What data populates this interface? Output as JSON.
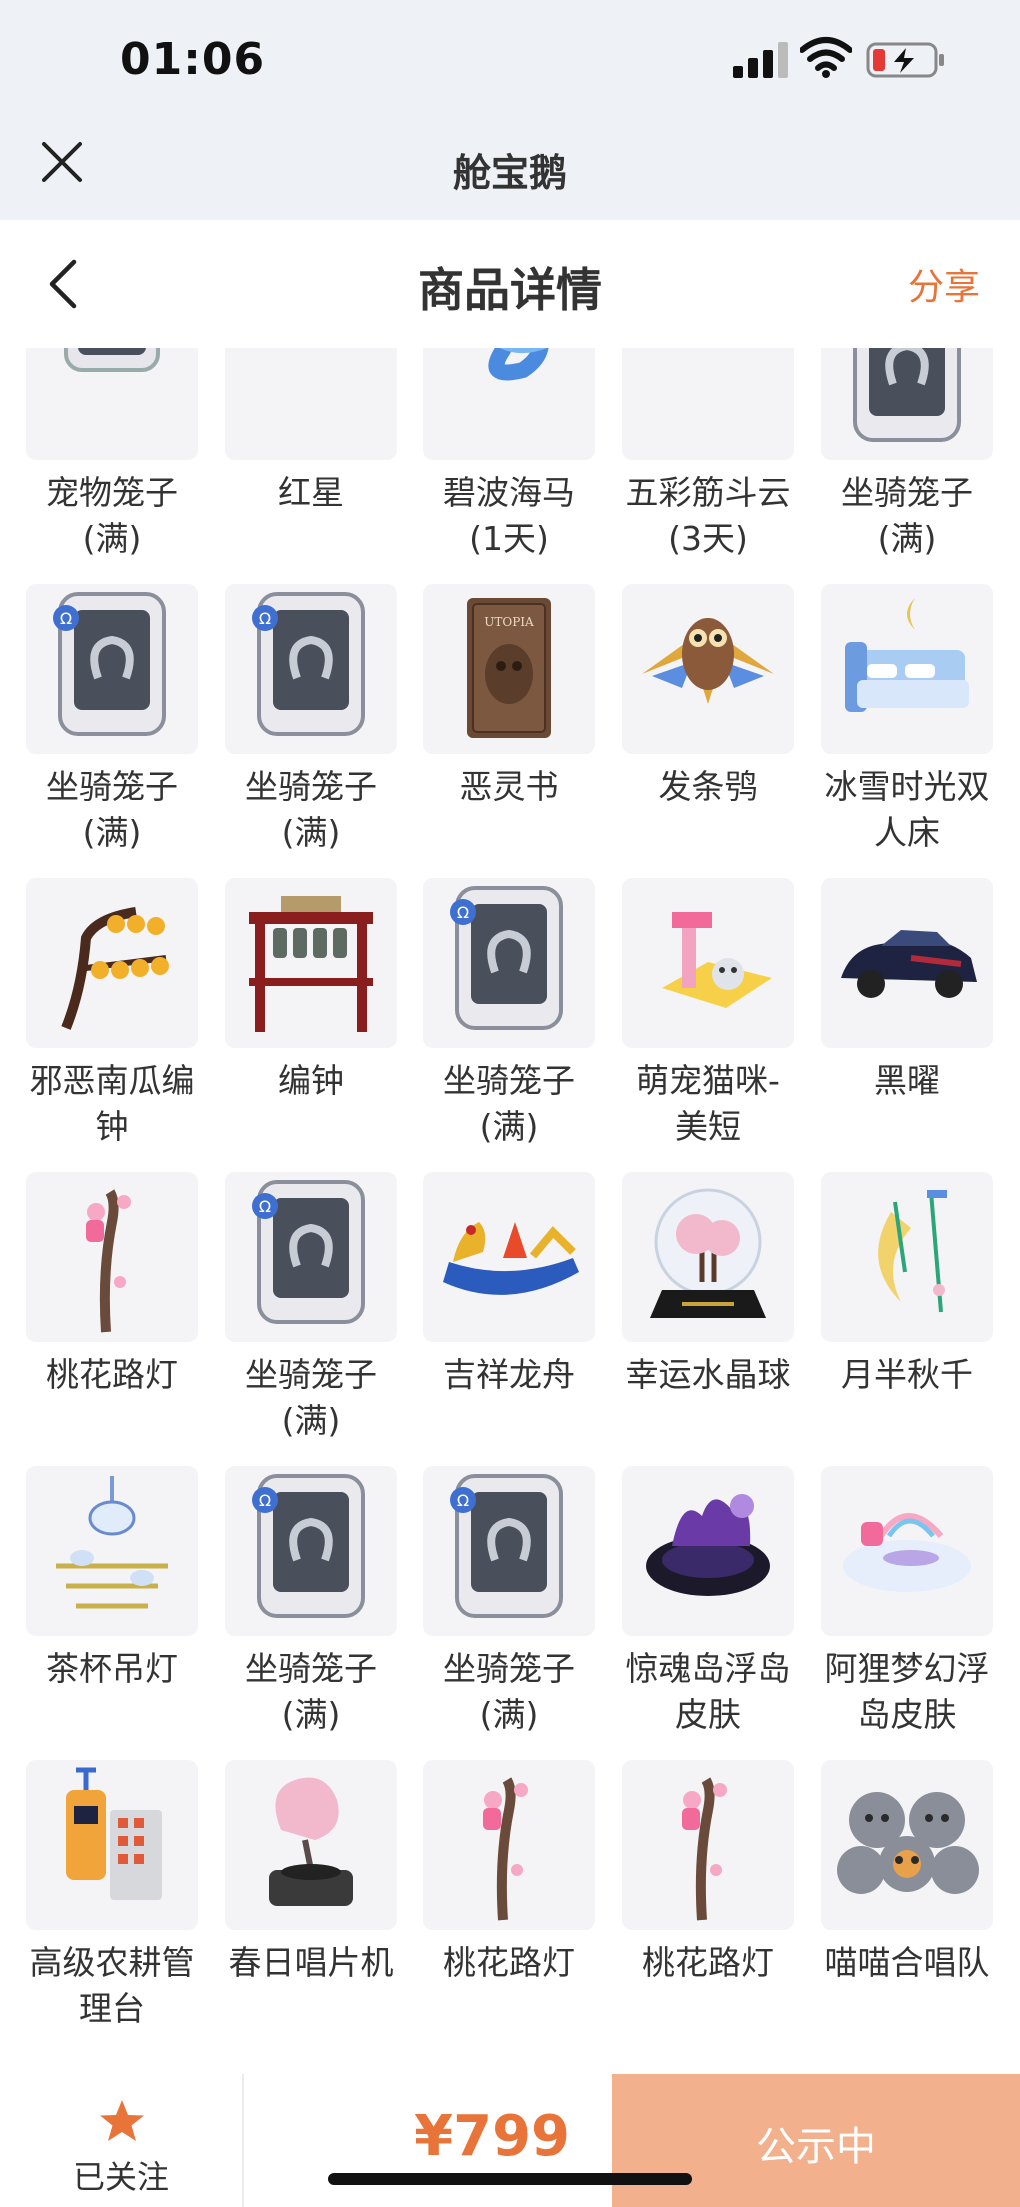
{
  "status_bar": {
    "time": "01:06"
  },
  "app_bar": {
    "title": "舱宝鹅"
  },
  "header": {
    "title": "商品详情",
    "share_label": "分享"
  },
  "grid": {
    "items": [
      {
        "name": "宠物笼子\n(满)",
        "icon": "pet-cage"
      },
      {
        "name": "红星",
        "icon": "motorcycle"
      },
      {
        "name": "碧波海马\n(1天)",
        "icon": "seahorse"
      },
      {
        "name": "五彩筋斗云\n(3天)",
        "icon": "cloud"
      },
      {
        "name": "坐骑笼子\n(满)",
        "icon": "mount-cage"
      },
      {
        "name": "坐骑笼子\n(满)",
        "icon": "mount-cage"
      },
      {
        "name": "坐骑笼子\n(满)",
        "icon": "mount-cage"
      },
      {
        "name": "恶灵书",
        "icon": "book"
      },
      {
        "name": "发条鸮",
        "icon": "owl"
      },
      {
        "name": "冰雪时光双\n人床",
        "icon": "bed"
      },
      {
        "name": "邪恶南瓜编\n钟",
        "icon": "pumpkin-tree"
      },
      {
        "name": "编钟",
        "icon": "chime-bells"
      },
      {
        "name": "坐骑笼子\n(满)",
        "icon": "mount-cage"
      },
      {
        "name": "萌宠猫咪-\n美短",
        "icon": "cat-house"
      },
      {
        "name": "黑曜",
        "icon": "car"
      },
      {
        "name": "桃花路灯",
        "icon": "peach-lamp"
      },
      {
        "name": "坐骑笼子\n(满)",
        "icon": "mount-cage"
      },
      {
        "name": "吉祥龙舟",
        "icon": "dragon-boat"
      },
      {
        "name": "幸运水晶球",
        "icon": "crystal-ball"
      },
      {
        "name": "月半秋千",
        "icon": "moon-swing"
      },
      {
        "name": "茶杯吊灯",
        "icon": "teacup-lamp"
      },
      {
        "name": "坐骑笼子\n(满)",
        "icon": "mount-cage"
      },
      {
        "name": "坐骑笼子\n(满)",
        "icon": "mount-cage"
      },
      {
        "name": "惊魂岛浮岛\n皮肤",
        "icon": "dark-island"
      },
      {
        "name": "阿狸梦幻浮\n岛皮肤",
        "icon": "dream-island"
      },
      {
        "name": "高级农耕管\n理台",
        "icon": "farm-console"
      },
      {
        "name": "春日唱片机",
        "icon": "gramophone"
      },
      {
        "name": "桃花路灯",
        "icon": "peach-lamp"
      },
      {
        "name": "桃花路灯",
        "icon": "peach-lamp"
      },
      {
        "name": "喵喵合唱队",
        "icon": "cat-choir"
      }
    ]
  },
  "bottom_bar": {
    "follow_label": "已关注",
    "price": "¥799",
    "status_label": "公示中"
  },
  "colors": {
    "accent": "#e8743a",
    "status_button": "#f2b08c",
    "app_bar_bg": "#eef1f5"
  }
}
